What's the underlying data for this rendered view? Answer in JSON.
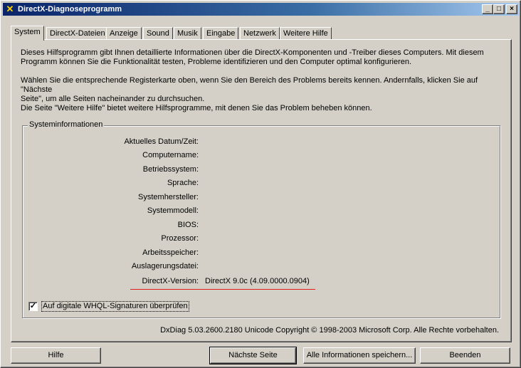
{
  "window": {
    "title": "DirectX-Diagnoseprogramm",
    "controls": {
      "minimize": "_",
      "maximize": "□",
      "close": "×"
    }
  },
  "tabs": [
    {
      "label": "System",
      "active": true
    },
    {
      "label": "DirectX-Dateien",
      "active": false
    },
    {
      "label": "Anzeige",
      "active": false
    },
    {
      "label": "Sound",
      "active": false
    },
    {
      "label": "Musik",
      "active": false
    },
    {
      "label": "Eingabe",
      "active": false
    },
    {
      "label": "Netzwerk",
      "active": false
    },
    {
      "label": "Weitere Hilfe",
      "active": false
    }
  ],
  "intro": {
    "p1_line1": "Dieses Hilfsprogramm gibt Ihnen detaillierte Informationen über die DirectX-Komponenten und -Treiber dieses Computers. Mit diesem",
    "p1_line2": "Programm können Sie die Funktionalität testen, Probleme identifizieren und den Computer optimal konfigurieren.",
    "p2_line1": "Wählen Sie die entsprechende Registerkarte oben, wenn Sie den Bereich des Problems bereits kennen. Andernfalls, klicken Sie auf \"Nächste",
    "p2_line2": "Seite\", um alle Seiten nacheinander zu durchsuchen.",
    "p3": "Die Seite \"Weitere Hilfe\" bietet weitere Hilfsprogramme, mit denen Sie das Problem beheben können."
  },
  "sysinfo": {
    "group_title": "Systeminformationen",
    "fields": [
      {
        "label": "Aktuelles Datum/Zeit:",
        "value": ""
      },
      {
        "label": "Computername:",
        "value": ""
      },
      {
        "label": "Betriebssystem:",
        "value": ""
      },
      {
        "label": "Sprache:",
        "value": ""
      },
      {
        "label": "Systemhersteller:",
        "value": ""
      },
      {
        "label": "Systemmodell:",
        "value": ""
      },
      {
        "label": "BIOS:",
        "value": ""
      },
      {
        "label": "Prozessor:",
        "value": ""
      },
      {
        "label": "Arbeitsspeicher:",
        "value": ""
      },
      {
        "label": "Auslagerungsdatei:",
        "value": ""
      },
      {
        "label": "DirectX-Version:",
        "value": "DirectX 9.0c (4.09.0000.0904)"
      }
    ],
    "whql_checkbox": {
      "label": "Auf  digitale WHQL-Signaturen überprüfen",
      "checked": true,
      "check_glyph": "✓"
    }
  },
  "footer": {
    "copyright": "DxDiag 5.03.2600.2180 Unicode  Copyright © 1998-2003 Microsoft Corp. Alle Rechte vorbehalten."
  },
  "buttons": {
    "help": "Hilfe",
    "next_page": "Nächste Seite",
    "save_all": "Alle Informationen speichern...",
    "exit": "Beenden"
  },
  "colors": {
    "titlebar_start": "#0a246a",
    "titlebar_end": "#a6caf0",
    "face": "#d4d0c8",
    "highlight_underline": "#e0201a"
  },
  "icons": {
    "app": "directx-x-icon"
  }
}
